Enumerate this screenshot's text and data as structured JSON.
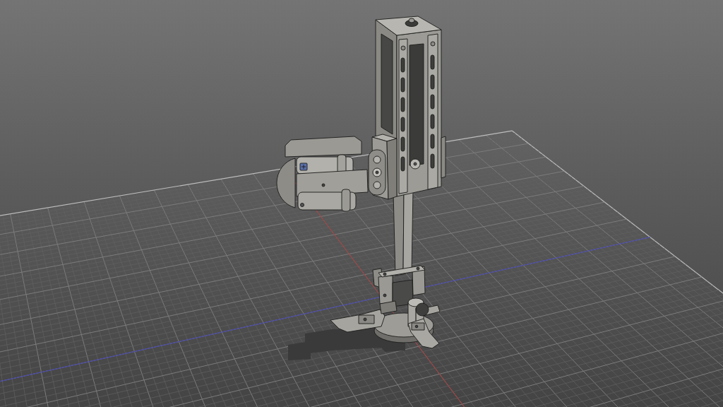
{
  "viewport": {
    "axes": [
      {
        "kind": "x",
        "color": "#b03a3a"
      },
      {
        "kind": "z",
        "color": "#4646b4"
      }
    ]
  }
}
